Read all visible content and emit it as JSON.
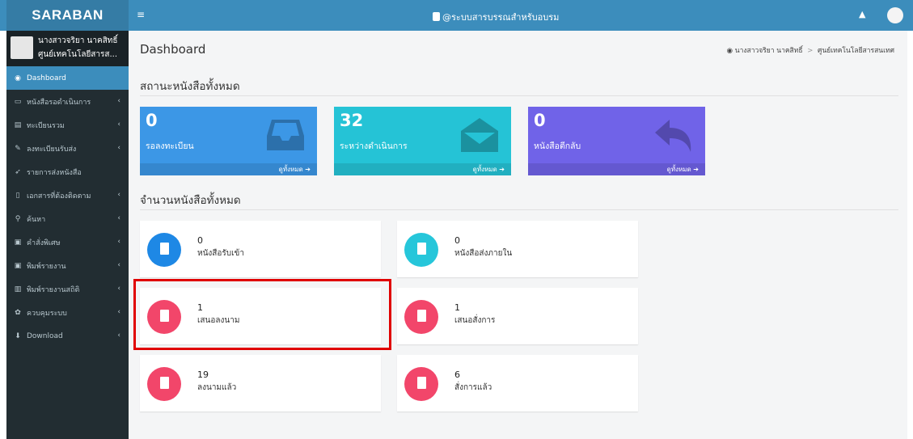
{
  "header": {
    "logo": "SARABAN",
    "menu_toggle": "≡",
    "title": "@ระบบสารบรรณสำหรับอบรม",
    "bell_icon": "bell-icon"
  },
  "user": {
    "name": "นางสาวจริยา นาคสิทธิ์",
    "org": "ศูนย์เทคโนโลยีสารส..."
  },
  "sidebar": {
    "items": [
      {
        "icon": "◉",
        "label": "Dashboard",
        "chevron": ""
      },
      {
        "icon": "▭",
        "label": "หนังสือรอดำเนินการ",
        "chevron": "‹"
      },
      {
        "icon": "▤",
        "label": "ทะเบียนรวม",
        "chevron": "‹"
      },
      {
        "icon": "✎",
        "label": "ลงทะเบียนรับส่ง",
        "chevron": "‹"
      },
      {
        "icon": "➶",
        "label": "รายการส่งหนังสือ",
        "chevron": ""
      },
      {
        "icon": "▯",
        "label": "เอกสารที่ต้องติดตาม",
        "chevron": "‹"
      },
      {
        "icon": "⚲",
        "label": "ค้นหา",
        "chevron": "‹"
      },
      {
        "icon": "▣",
        "label": "คำสั่งพิเศษ",
        "chevron": "‹"
      },
      {
        "icon": "▣",
        "label": "พิมพ์รายงาน",
        "chevron": "‹"
      },
      {
        "icon": "▥",
        "label": "พิมพ์รายงานสถิติ",
        "chevron": "‹"
      },
      {
        "icon": "✿",
        "label": "ควบคุมระบบ",
        "chevron": "‹"
      },
      {
        "icon": "⬇",
        "label": "Download",
        "chevron": "‹"
      }
    ]
  },
  "page": {
    "title": "Dashboard",
    "breadcrumb_user": "นางสาวจริยา นาคสิทธิ์",
    "breadcrumb_sep": ">",
    "breadcrumb_org": "ศูนย์เทคโนโลยีสารสนเทศ",
    "section1": "สถานะหนังสือทั้งหมด",
    "section2": "จำนวนหนังสือทั้งหมด"
  },
  "status_boxes": [
    {
      "value": "0",
      "label": "รอลงทะเบียน",
      "link": "ดูทั้งหมด ➔",
      "color": "#3c97e6",
      "icon": "inbox-icon"
    },
    {
      "value": "32",
      "label": "ระหว่างดำเนินการ",
      "link": "ดูทั้งหมด ➔",
      "color": "#25c3d6",
      "icon": "envelope-open-icon"
    },
    {
      "value": "0",
      "label": "หนังสือตีกลับ",
      "link": "ดูทั้งหมด ➔",
      "color": "#7063e8",
      "icon": "reply-icon"
    }
  ],
  "cards": [
    {
      "value": "0",
      "label": "หนังสือรับเข้า",
      "color": "#1e88e5"
    },
    {
      "value": "0",
      "label": "หนังสือส่งภายใน",
      "color": "#26c6da"
    },
    {
      "value": "1",
      "label": "เสนอลงนาม",
      "color": "#f2466a"
    },
    {
      "value": "1",
      "label": "เสนอสั่งการ",
      "color": "#f2466a"
    },
    {
      "value": "19",
      "label": "ลงนามแล้ว",
      "color": "#f2466a"
    },
    {
      "value": "6",
      "label": "สั่งการแล้ว",
      "color": "#f2466a"
    }
  ]
}
